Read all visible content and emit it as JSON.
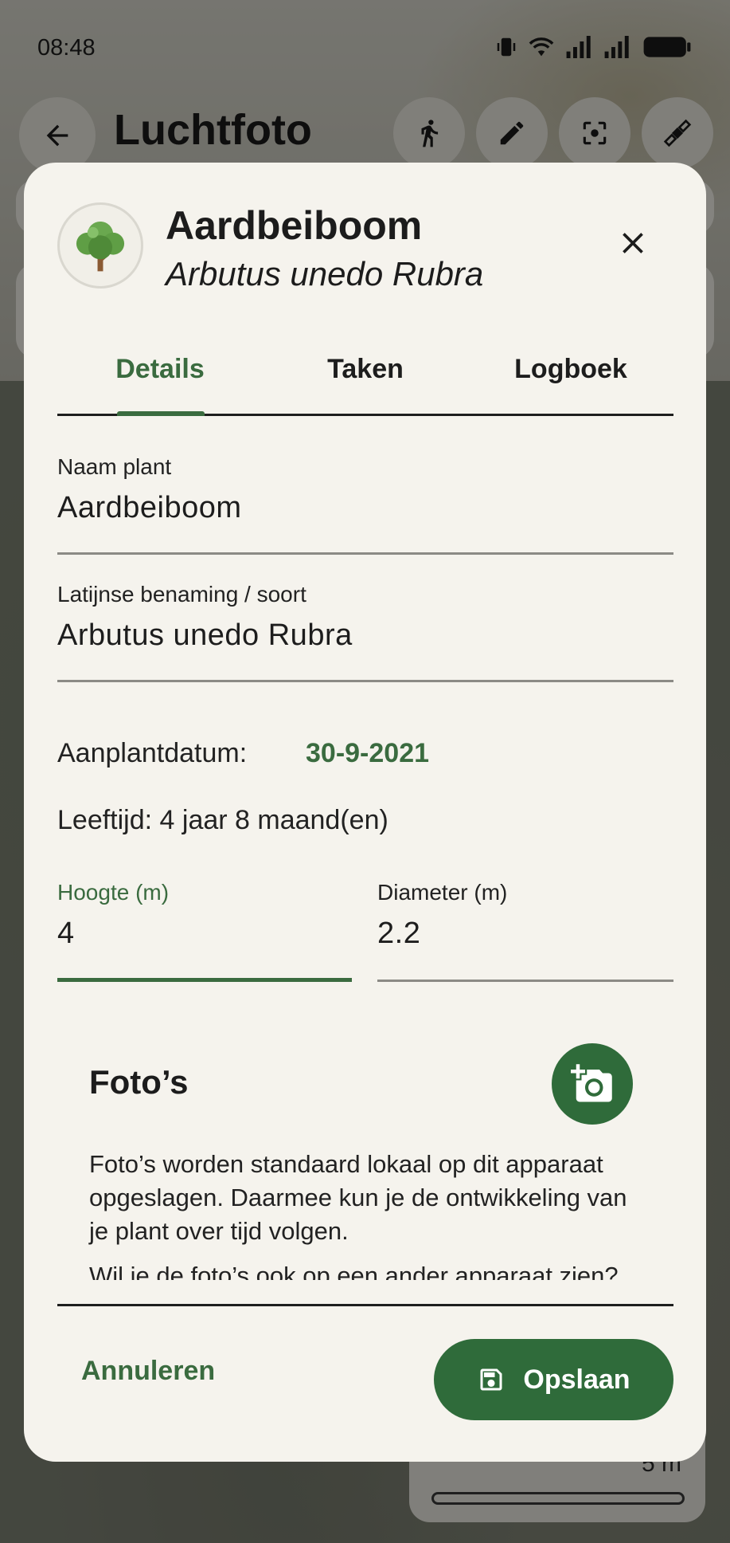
{
  "status_bar": {
    "time": "08:48"
  },
  "app_bar": {
    "title": "Luchtfoto",
    "actions": [
      "walk-icon",
      "edit-icon",
      "center-focus-icon",
      "satellite-icon"
    ]
  },
  "background": {
    "scale_label": "5 m"
  },
  "dialog": {
    "title": "Aardbeiboom",
    "subtitle": "Arbutus unedo Rubra",
    "tabs": [
      {
        "label": "Details",
        "selected": true
      },
      {
        "label": "Taken",
        "selected": false
      },
      {
        "label": "Logboek",
        "selected": false
      }
    ],
    "fields": {
      "name": {
        "label": "Naam plant",
        "value": "Aardbeiboom"
      },
      "latin": {
        "label": "Latijnse benaming / soort",
        "value": "Arbutus unedo Rubra"
      }
    },
    "planting_date": {
      "label": "Aanplantdatum:",
      "value": "30-9-2021"
    },
    "age": "Leeftijd: 4 jaar 8 maand(en)",
    "height": {
      "label": "Hoogte (m)",
      "value": "4"
    },
    "diameter": {
      "label": "Diameter (m)",
      "value": "2.2"
    },
    "photos": {
      "title": "Foto’s",
      "text": "Foto’s worden standaard lokaal op dit apparaat opgeslagen. Daarmee kun je de ontwikkeling van je plant over tijd volgen.",
      "text2": "Wil je de foto’s ook op een ander apparaat zien?"
    },
    "actions": {
      "cancel": "Annuleren",
      "save": "Opslaan"
    }
  },
  "colors": {
    "accent": "#3a6b3f",
    "button": "#2f6b3a",
    "surface": "#f5f3ed"
  }
}
